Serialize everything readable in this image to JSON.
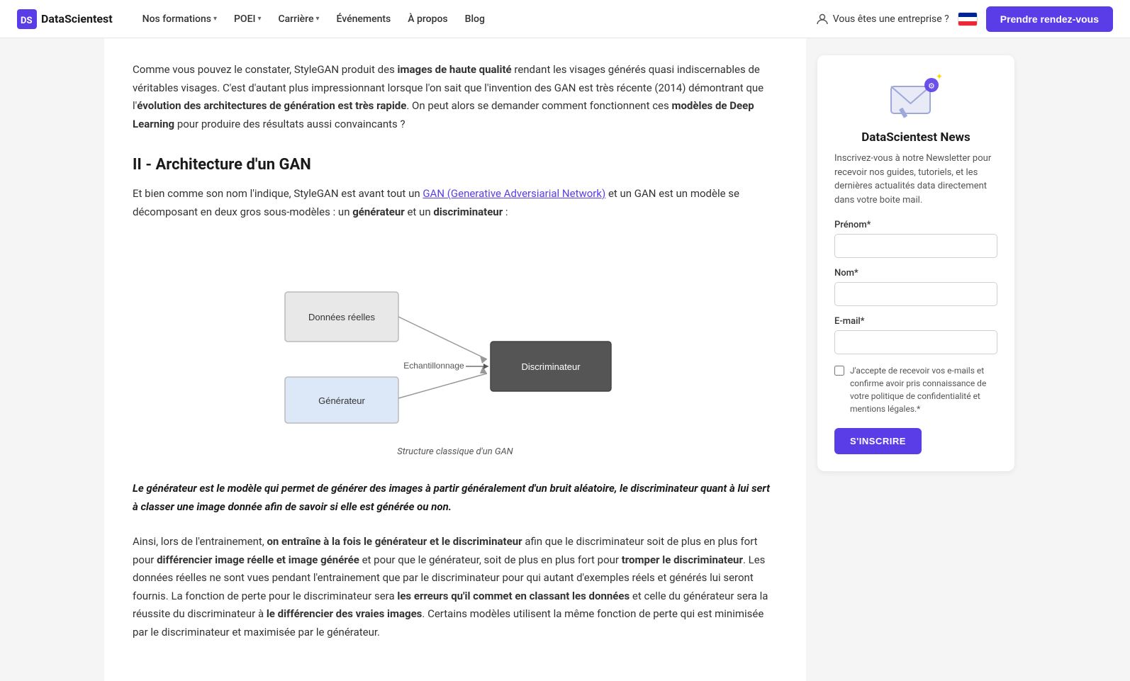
{
  "nav": {
    "logo_text": "DataScientest",
    "items": [
      {
        "label": "Nos formations",
        "has_dropdown": true
      },
      {
        "label": "POEI",
        "has_dropdown": true
      },
      {
        "label": "Carrière",
        "has_dropdown": true
      },
      {
        "label": "Événements",
        "has_dropdown": false
      },
      {
        "label": "À propos",
        "has_dropdown": false
      },
      {
        "label": "Blog",
        "has_dropdown": false
      }
    ],
    "enterprise_label": "Vous êtes une entreprise ?",
    "cta_label": "Prendre rendez-vous"
  },
  "article": {
    "intro": {
      "text_1": "Comme vous pouvez le constater, StyleGAN produit des ",
      "bold_1": "images de haute qualité",
      "text_2": " rendant les visages générés quasi indiscernables de véritables visages. C'est d'autant plus impressionnant lorsque l'on sait que l'invention des GAN est très récente (2014) démontrant que l'",
      "bold_2": "évolution des architectures de génération est très rapide",
      "text_3": ". On peut alors se demander comment fonctionnent ces ",
      "bold_3": "modèles de Deep Learning",
      "text_4": " pour produire des résultats aussi convaincants ?"
    },
    "section_title": "II - Architecture d'un GAN",
    "section_para1": {
      "text_1": "Et bien comme son nom l'indique, StyleGAN est avant tout un ",
      "link_text": "GAN (Generative Adversiarial Network)",
      "text_2": " et un GAN est un modèle se décomposant en deux gros sous-modèles : un ",
      "bold_1": "générateur",
      "text_3": " et un ",
      "bold_2": "discriminateur",
      "text_4": " :"
    },
    "diagram_caption": "Structure classique d'un GAN",
    "diagram": {
      "box1_label": "Données réelles",
      "box2_label": "Générateur",
      "arrow_label": "Echantillonnage",
      "box3_label": "Discriminateur"
    },
    "blockquote": "Le générateur est le modèle qui permet de générer des images à partir généralement d'un bruit aléatoire, le discriminateur quant à lui sert à classer une image donnée afin de savoir si elle est générée ou non.",
    "para2": {
      "text_1": "Ainsi, lors de l'entrainement, ",
      "bold_1": "on entraîne à la fois le générateur et le discriminateur",
      "text_2": " afin que le discriminateur soit de plus en plus fort pour ",
      "bold_2": "différencier image réelle et image générée",
      "text_3": " et pour que le générateur, soit de plus en plus fort pour ",
      "bold_3": "tromper le discriminateur",
      "text_4": ". Les données réelles ne sont vues pendant l'entrainement que par le discriminateur pour qui autant d'exemples réels et générés lui seront fournis. La fonction de perte pour le discriminateur sera ",
      "bold_4": "les erreurs qu'il commet en classant les données",
      "text_5": " et celle du générateur sera la réussite du discriminateur à ",
      "bold_5": "le différencier des vraies images",
      "text_6": ". Certains modèles utilisent la même fonction de perte qui est minimisée par le discriminateur et maximisée par le générateur."
    }
  },
  "sidebar": {
    "newsletter": {
      "title": "DataScientest News",
      "description": "Inscrivez-vous à notre Newsletter pour recevoir nos guides, tutoriels, et les dernières actualités data directement dans votre boite mail.",
      "prenom_label": "Prénom*",
      "nom_label": "Nom*",
      "email_label": "E-mail*",
      "checkbox_text": "J'accepte de recevoir vos e-mails et confirme avoir pris connaissance de votre politique de confidentialité et mentions légales.*",
      "submit_label": "S'INSCRIRE"
    }
  }
}
